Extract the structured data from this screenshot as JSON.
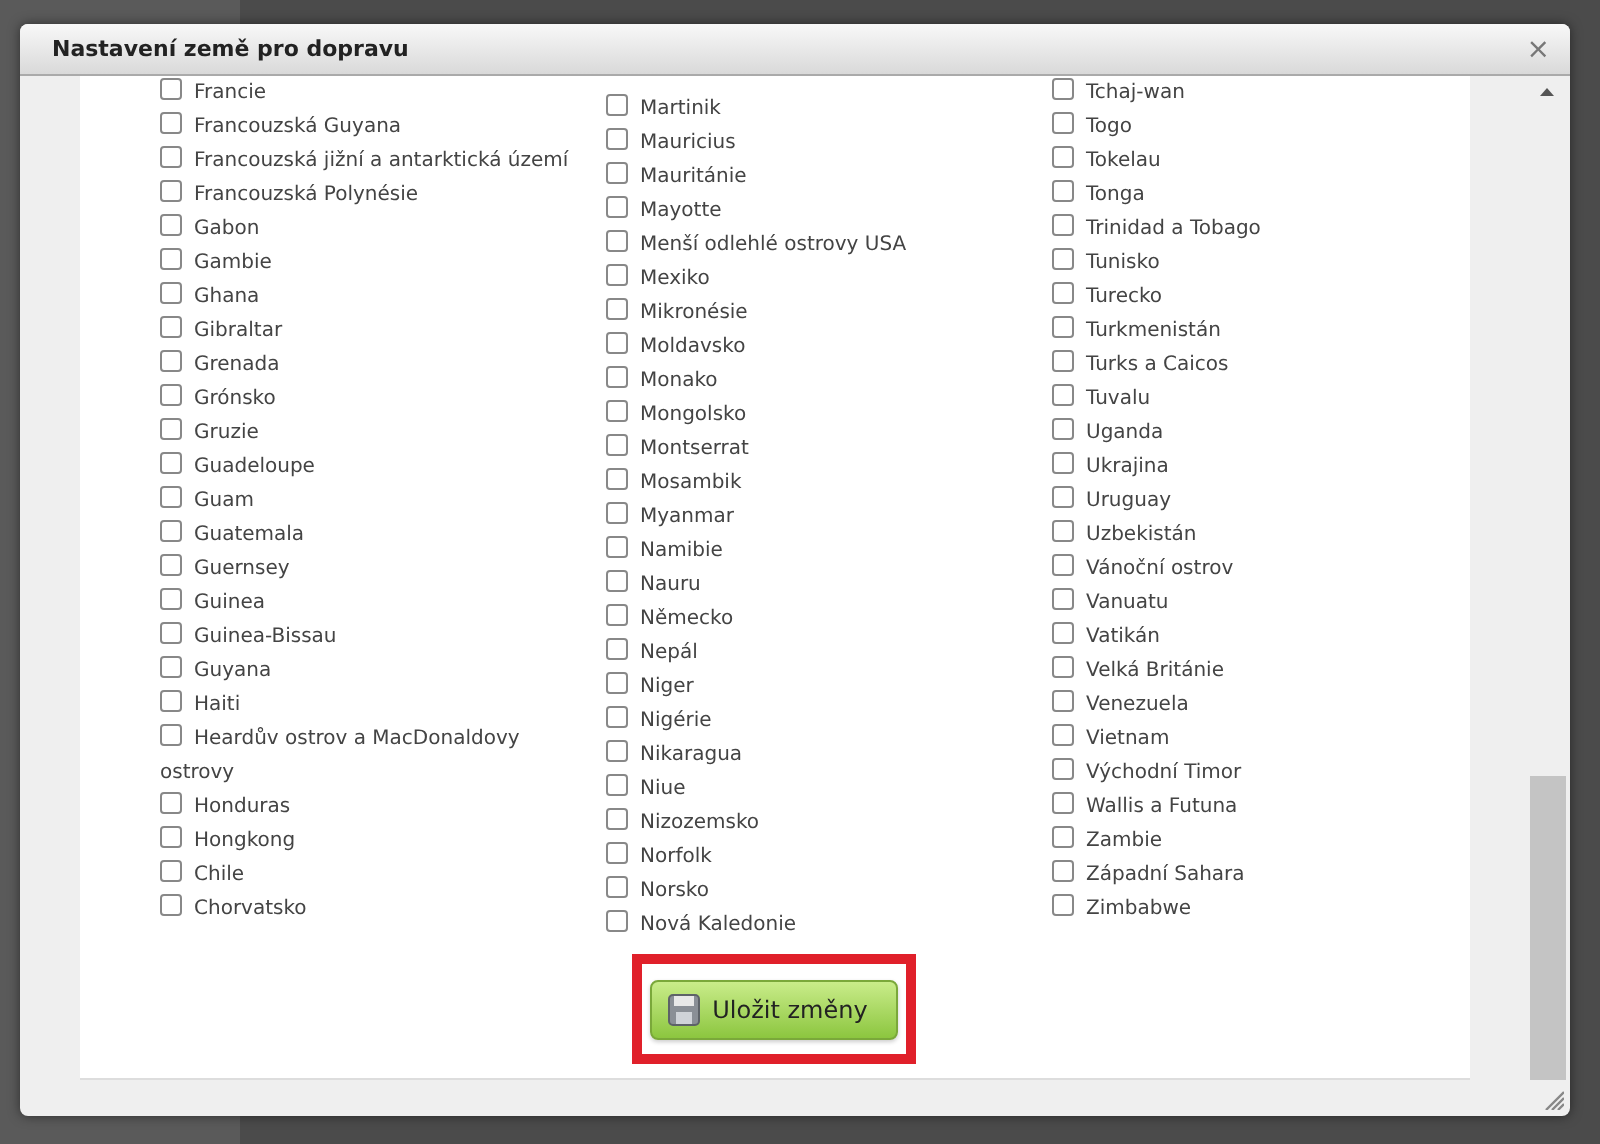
{
  "dialog": {
    "title": "Nastavení země pro dopravu",
    "close": "×"
  },
  "columns": [
    {
      "items": [
        {
          "label": "Francie",
          "checked": false
        },
        {
          "label": "Francouzská Guyana",
          "checked": false
        },
        {
          "label": "Francouzská jižní a antarktická území",
          "checked": false
        },
        {
          "label": "Francouzská Polynésie",
          "checked": false
        },
        {
          "label": "Gabon",
          "checked": false
        },
        {
          "label": "Gambie",
          "checked": false
        },
        {
          "label": "Ghana",
          "checked": false
        },
        {
          "label": "Gibraltar",
          "checked": false
        },
        {
          "label": "Grenada",
          "checked": false
        },
        {
          "label": "Grónsko",
          "checked": false
        },
        {
          "label": "Gruzie",
          "checked": false
        },
        {
          "label": "Guadeloupe",
          "checked": false
        },
        {
          "label": "Guam",
          "checked": false
        },
        {
          "label": "Guatemala",
          "checked": false
        },
        {
          "label": "Guernsey",
          "checked": false
        },
        {
          "label": "Guinea",
          "checked": false
        },
        {
          "label": "Guinea-Bissau",
          "checked": false
        },
        {
          "label": "Guyana",
          "checked": false
        },
        {
          "label": "Haiti",
          "checked": false
        },
        {
          "label": "Heardův ostrov a MacDonaldovy ostrovy",
          "checked": false
        },
        {
          "label": "Honduras",
          "checked": false
        },
        {
          "label": "Hongkong",
          "checked": false
        },
        {
          "label": "Chile",
          "checked": false
        },
        {
          "label": "Chorvatsko",
          "checked": false
        }
      ]
    },
    {
      "items": [
        {
          "label": "Martinik",
          "checked": false
        },
        {
          "label": "Mauricius",
          "checked": false
        },
        {
          "label": "Mauritánie",
          "checked": false
        },
        {
          "label": "Mayotte",
          "checked": false
        },
        {
          "label": "Menší odlehlé ostrovy USA",
          "checked": false
        },
        {
          "label": "Mexiko",
          "checked": false
        },
        {
          "label": "Mikronésie",
          "checked": false
        },
        {
          "label": "Moldavsko",
          "checked": false
        },
        {
          "label": "Monako",
          "checked": false
        },
        {
          "label": "Mongolsko",
          "checked": false
        },
        {
          "label": "Montserrat",
          "checked": false
        },
        {
          "label": "Mosambik",
          "checked": false
        },
        {
          "label": "Myanmar",
          "checked": false
        },
        {
          "label": "Namibie",
          "checked": false
        },
        {
          "label": "Nauru",
          "checked": false
        },
        {
          "label": "Německo",
          "checked": false
        },
        {
          "label": "Nepál",
          "checked": false
        },
        {
          "label": "Niger",
          "checked": false
        },
        {
          "label": "Nigérie",
          "checked": false
        },
        {
          "label": "Nikaragua",
          "checked": false
        },
        {
          "label": "Niue",
          "checked": false
        },
        {
          "label": "Nizozemsko",
          "checked": false
        },
        {
          "label": "Norfolk",
          "checked": false
        },
        {
          "label": "Norsko",
          "checked": false
        },
        {
          "label": "Nová Kaledonie",
          "checked": false
        }
      ]
    },
    {
      "items": [
        {
          "label": "Tchaj-wan",
          "checked": false
        },
        {
          "label": "Togo",
          "checked": false
        },
        {
          "label": "Tokelau",
          "checked": false
        },
        {
          "label": "Tonga",
          "checked": false
        },
        {
          "label": "Trinidad a Tobago",
          "checked": false
        },
        {
          "label": "Tunisko",
          "checked": false
        },
        {
          "label": "Turecko",
          "checked": false
        },
        {
          "label": "Turkmenistán",
          "checked": false
        },
        {
          "label": "Turks a Caicos",
          "checked": false
        },
        {
          "label": "Tuvalu",
          "checked": false
        },
        {
          "label": "Uganda",
          "checked": false
        },
        {
          "label": "Ukrajina",
          "checked": false
        },
        {
          "label": "Uruguay",
          "checked": false
        },
        {
          "label": "Uzbekistán",
          "checked": false
        },
        {
          "label": "Vánoční ostrov",
          "checked": false
        },
        {
          "label": "Vanuatu",
          "checked": false
        },
        {
          "label": "Vatikán",
          "checked": false
        },
        {
          "label": "Velká Británie",
          "checked": false
        },
        {
          "label": "Venezuela",
          "checked": false
        },
        {
          "label": "Vietnam",
          "checked": false
        },
        {
          "label": "Východní Timor",
          "checked": false
        },
        {
          "label": "Wallis a Futuna",
          "checked": false
        },
        {
          "label": "Zambie",
          "checked": false
        },
        {
          "label": "Západní Sahara",
          "checked": false
        },
        {
          "label": "Zimbabwe",
          "checked": false
        }
      ]
    }
  ],
  "save_button": {
    "label": "Uložit změny"
  }
}
